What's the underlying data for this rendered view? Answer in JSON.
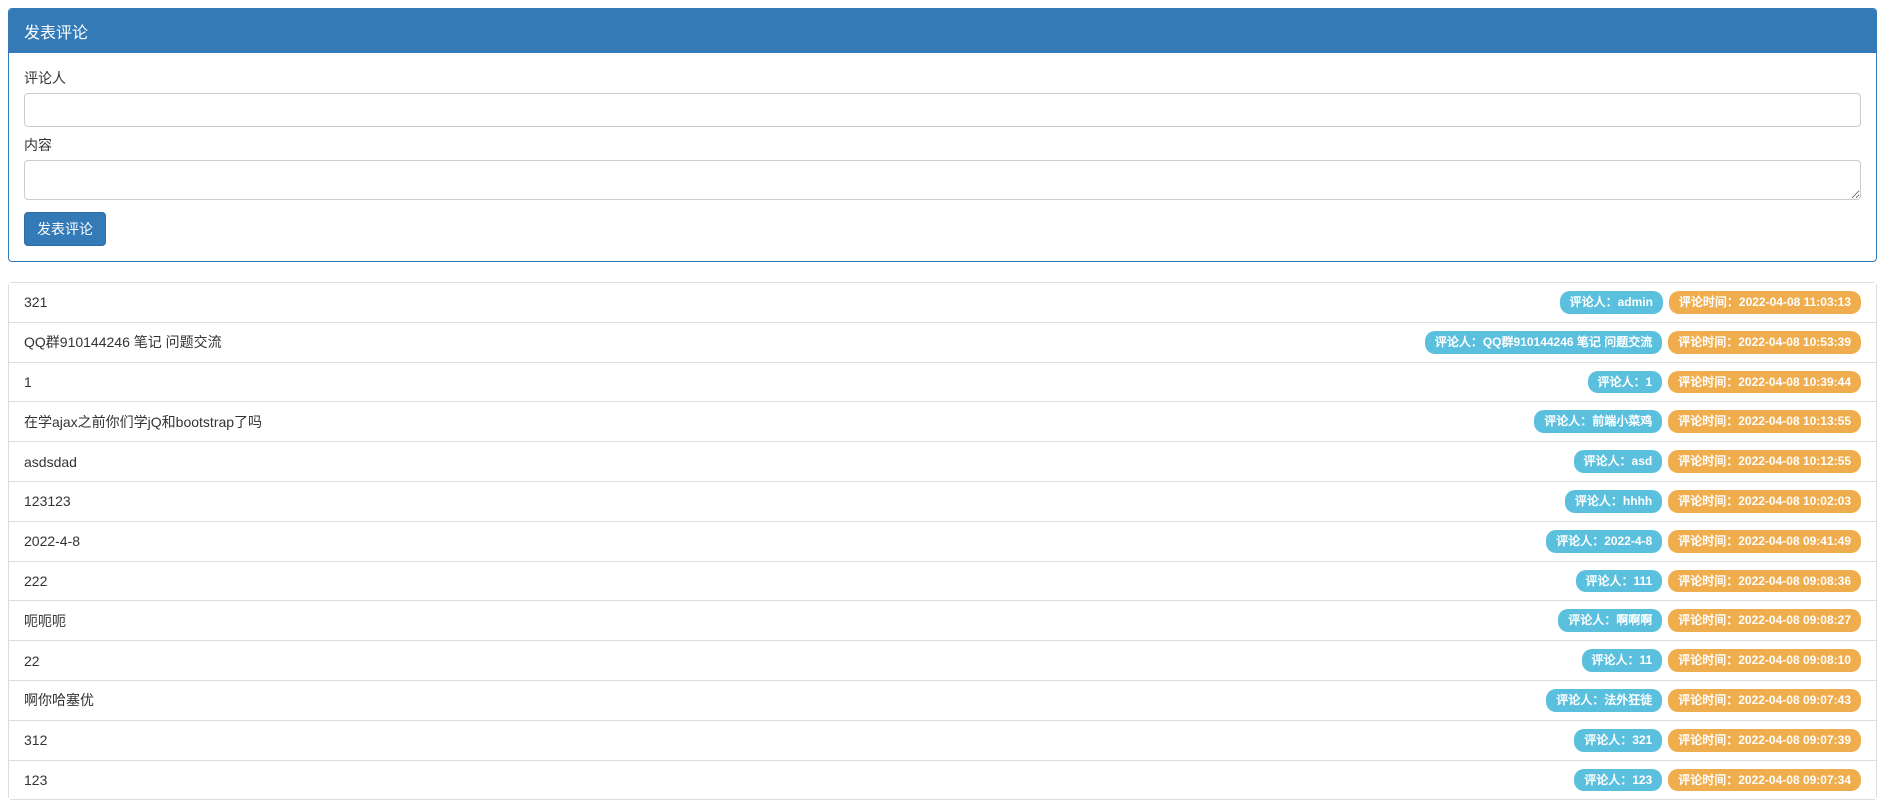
{
  "panel": {
    "title": "发表评论",
    "commenterLabel": "评论人",
    "contentLabel": "内容",
    "submitLabel": "发表评论"
  },
  "labels": {
    "commenterPrefix": "评论人：",
    "timePrefix": "评论时间："
  },
  "comments": [
    {
      "content": "321",
      "commenter": "admin",
      "time": "2022-04-08 11:03:13"
    },
    {
      "content": "QQ群910144246 笔记 问题交流",
      "commenter": "QQ群910144246 笔记 问题交流",
      "time": "2022-04-08 10:53:39"
    },
    {
      "content": "1",
      "commenter": "1",
      "time": "2022-04-08 10:39:44"
    },
    {
      "content": "在学ajax之前你们学jQ和bootstrap了吗",
      "commenter": "前端小菜鸡",
      "time": "2022-04-08 10:13:55"
    },
    {
      "content": "asdsdad",
      "commenter": "asd",
      "time": "2022-04-08 10:12:55"
    },
    {
      "content": "123123",
      "commenter": "hhhh",
      "time": "2022-04-08 10:02:03"
    },
    {
      "content": "2022-4-8",
      "commenter": "2022-4-8",
      "time": "2022-04-08 09:41:49"
    },
    {
      "content": "222",
      "commenter": "111",
      "time": "2022-04-08 09:08:36"
    },
    {
      "content": "呃呃呃",
      "commenter": "啊啊啊",
      "time": "2022-04-08 09:08:27"
    },
    {
      "content": "22",
      "commenter": "11",
      "time": "2022-04-08 09:08:10"
    },
    {
      "content": "啊你哈塞优",
      "commenter": "法外狂徒",
      "time": "2022-04-08 09:07:43"
    },
    {
      "content": "312",
      "commenter": "321",
      "time": "2022-04-08 09:07:39"
    },
    {
      "content": "123",
      "commenter": "123",
      "time": "2022-04-08 09:07:34"
    }
  ]
}
